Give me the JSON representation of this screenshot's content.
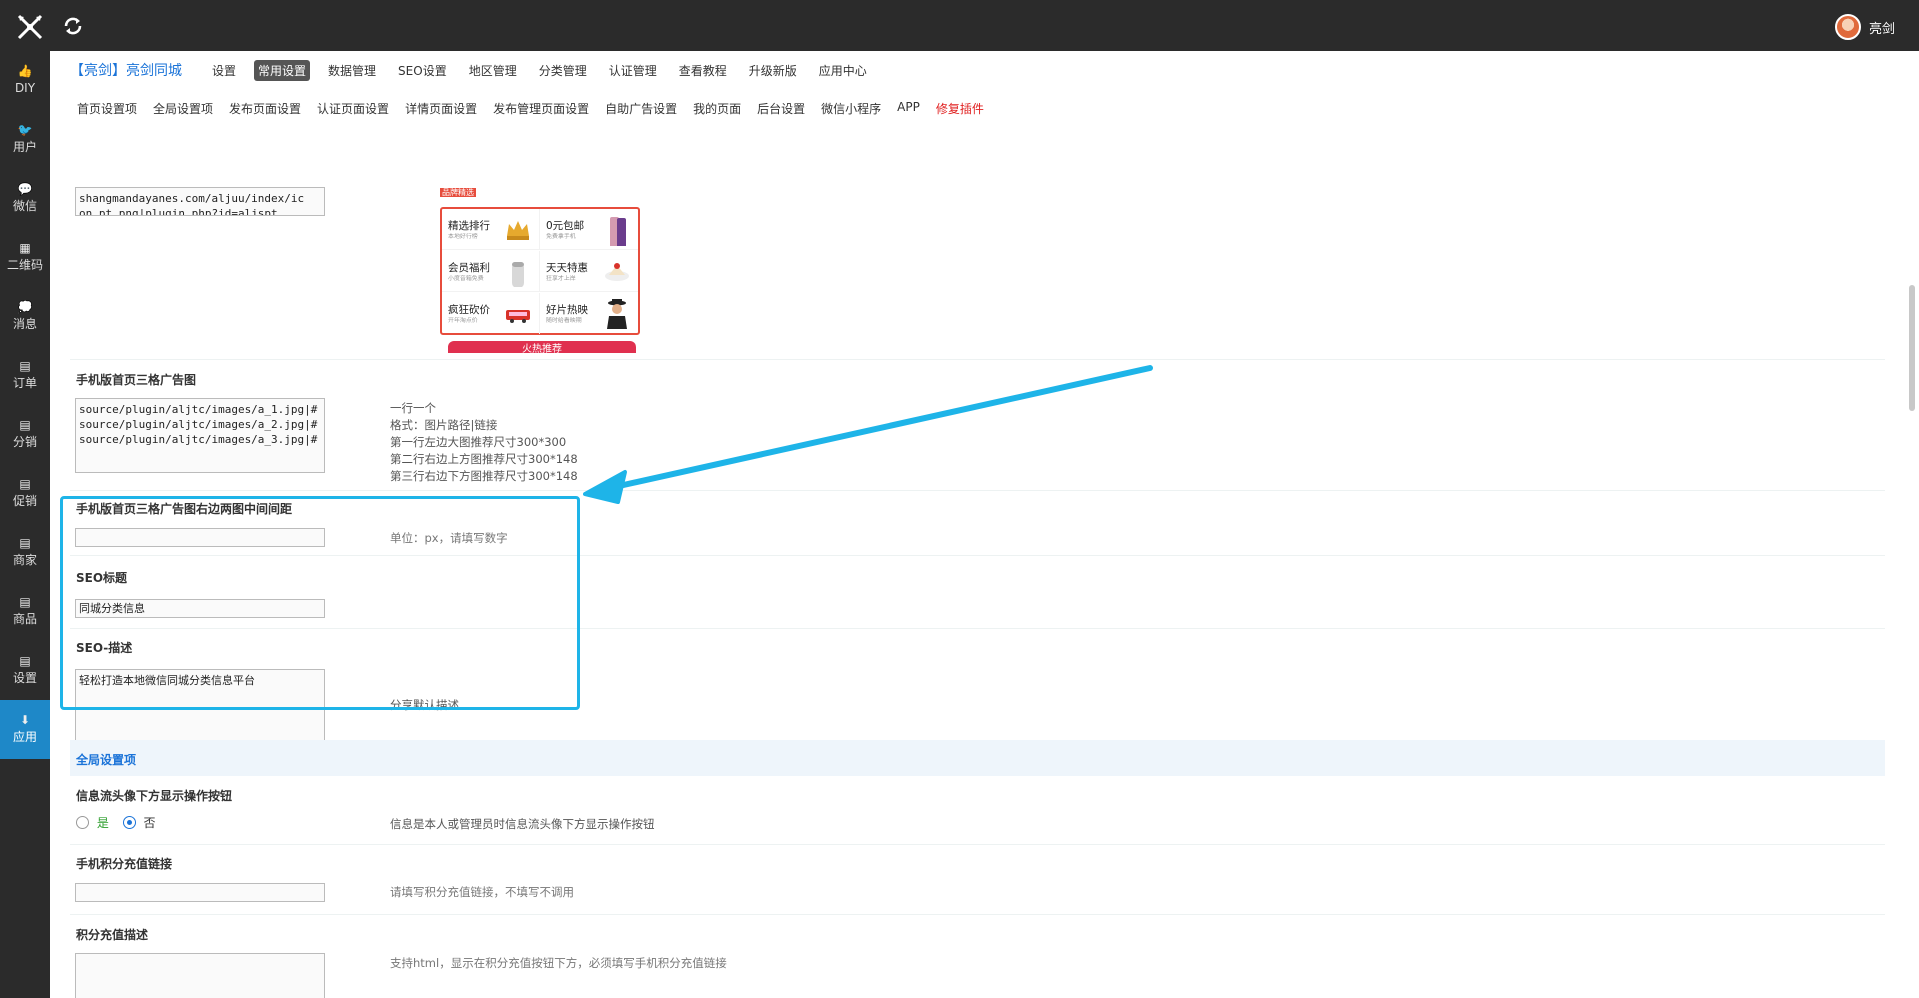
{
  "topbar": {
    "logo_icon": "crossed-swords-logo",
    "refresh_icon": "refresh-icon",
    "username": "亮剑"
  },
  "sidebar": {
    "items": [
      {
        "icon": "👍",
        "label": "DIY"
      },
      {
        "icon": "🐦",
        "label": "用户"
      },
      {
        "icon": "💬",
        "label": "微信"
      },
      {
        "icon": "▦",
        "label": "二维码"
      },
      {
        "icon": "💭",
        "label": "消息"
      },
      {
        "icon": "▤",
        "label": "订单"
      },
      {
        "icon": "▤",
        "label": "分销"
      },
      {
        "icon": "▤",
        "label": "促销"
      },
      {
        "icon": "▤",
        "label": "商家"
      },
      {
        "icon": "▤",
        "label": "商品"
      },
      {
        "icon": "▤",
        "label": "设置"
      },
      {
        "icon": "⬇",
        "label": "应用"
      }
    ],
    "active_index": 11
  },
  "nav1": {
    "brand": "【亮剑】亮剑同城",
    "items": [
      "设置",
      "常用设置",
      "数据管理",
      "SEO设置",
      "地区管理",
      "分类管理",
      "认证管理",
      "查看教程",
      "升级新版",
      "应用中心"
    ],
    "active": "常用设置"
  },
  "nav2": {
    "items": [
      "首页设置项",
      "全局设置项",
      "发布页面设置",
      "认证页面设置",
      "详情页面设置",
      "发布管理页面设置",
      "自助广告设置",
      "我的页面",
      "后台设置",
      "微信小程序",
      "APP"
    ],
    "red_item": "修复插件"
  },
  "top_textarea": {
    "value": "shangmandayanes.com/aljuu/index/ic\non_pt.png|plugin.php?id=aljspt\n帮助中心|平台页面"
  },
  "ad_preview": {
    "header_text": "品牌精选",
    "cells": [
      {
        "title": "精选排行",
        "sub": "本地好行榜",
        "img": "crown-image"
      },
      {
        "title": "0元包邮",
        "sub": "免费拿手机",
        "img": "phone-image"
      },
      {
        "title": "会员福利",
        "sub": "小度音箱免费",
        "img": "speaker-image"
      },
      {
        "title": "天天特惠",
        "sub": "狂享才上岸",
        "img": "cake-image"
      },
      {
        "title": "疯狂砍价",
        "sub": "开年淘点价",
        "img": "bus-image"
      },
      {
        "title": "好片热映",
        "sub": "随时给看映期",
        "img": "person-image"
      }
    ],
    "bottom_banner": "火热推荐"
  },
  "fields": {
    "three_grid": {
      "label": "手机版首页三格广告图",
      "value": "source/plugin/aljtc/images/a_1.jpg|#\nsource/plugin/aljtc/images/a_2.jpg|#\nsource/plugin/aljtc/images/a_3.jpg|#",
      "tip": "一行一个\n格式：图片路径|链接\n第一行左边大图推荐尺寸300*300\n第二行右边上方图推荐尺寸300*148\n第三行右边下方图推荐尺寸300*148"
    },
    "gap": {
      "label": "手机版首页三格广告图右边两图中间间距",
      "value": "",
      "tip": "单位：px，请填写数字"
    },
    "seo_title": {
      "label": "SEO标题",
      "value": "同城分类信息"
    },
    "seo_desc": {
      "label": "SEO-描述",
      "value": "轻松打造本地微信同城分类信息平台",
      "tip": "分享默认描述"
    }
  },
  "global_section": {
    "title": "全局设置项"
  },
  "global_fields": {
    "show_btn": {
      "label": "信息流头像下方显示操作按钮",
      "yes": "是",
      "no": "否",
      "selected": "否",
      "tip": "信息是本人或管理员时信息流头像下方显示操作按钮"
    },
    "recharge_link": {
      "label": "手机积分充值链接",
      "value": "",
      "tip": "请填写积分充值链接，不填写不调用"
    },
    "recharge_desc": {
      "label": "积分充值描述",
      "value": "",
      "tip": "支持html，显示在积分充值按钮下方，必须填写手机积分充值链接"
    }
  },
  "colors": {
    "topbar": "#2b2b2b",
    "accent": "#1a73d8",
    "highlight": "#1eb4e8",
    "active_sidebar": "#1e88c8"
  }
}
